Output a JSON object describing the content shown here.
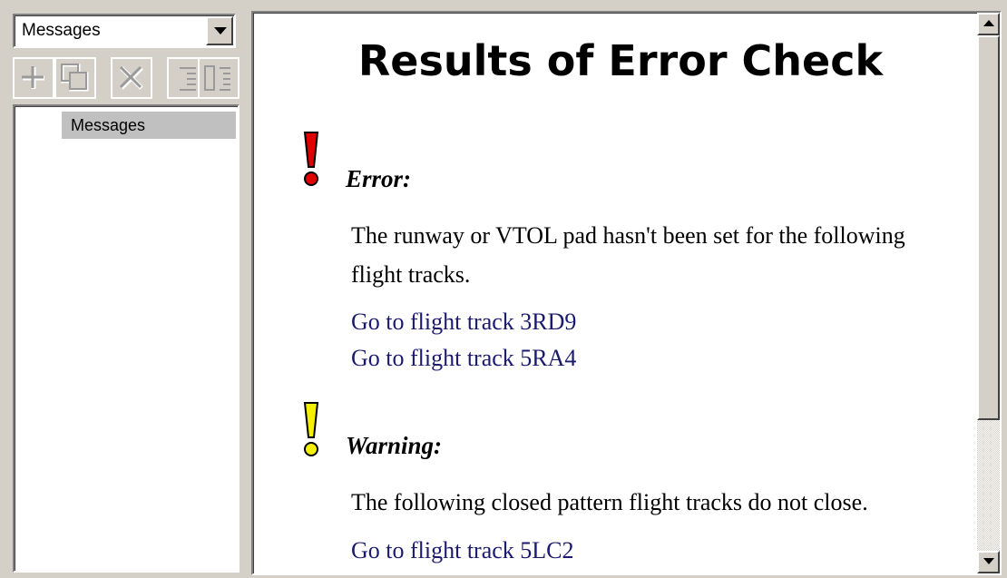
{
  "left_panel": {
    "dropdown": {
      "selected": "Messages"
    },
    "toolbar": {
      "buttons": [
        "add-icon",
        "copy-icon",
        "delete-icon",
        "expand-icon",
        "collapse-icon"
      ]
    },
    "tree": {
      "items": [
        {
          "label": "Messages",
          "selected": true
        }
      ]
    }
  },
  "document": {
    "title": "Results of Error Check",
    "sections": [
      {
        "kind": "error",
        "icon_color": "#e00000",
        "heading": "Error:",
        "text": "The runway or VTOL pad hasn't been set for the following flight tracks.",
        "links": [
          "Go to flight track 3RD9",
          "Go to flight track 5RA4"
        ]
      },
      {
        "kind": "warning",
        "icon_color": "#f4f000",
        "heading": "Warning:",
        "text": "The following closed pattern flight tracks do not close.",
        "links": [
          "Go to flight track 5LC2"
        ]
      }
    ]
  },
  "colors": {
    "window_bg": "#d4d0c8",
    "link": "#1a1a6e",
    "error": "#e00000",
    "warning": "#f4f000"
  }
}
